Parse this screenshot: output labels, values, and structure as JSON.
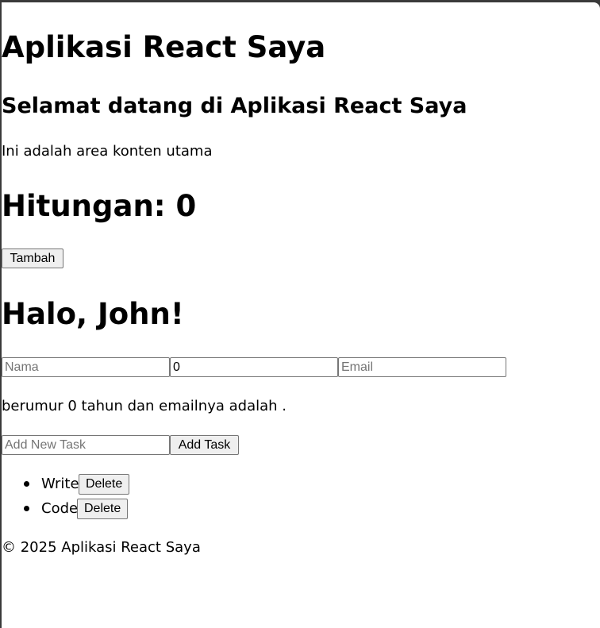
{
  "header": {
    "title": "Aplikasi React Saya"
  },
  "main": {
    "welcome_title": "Selamat datang di Aplikasi React Saya",
    "description": "Ini adalah area konten utama"
  },
  "counter": {
    "label": "Hitungan: 0",
    "add_button_label": "Tambah"
  },
  "user": {
    "greeting": "Halo, John!",
    "name_field": {
      "value": "",
      "placeholder": "Nama"
    },
    "age_field": {
      "value": "0",
      "placeholder": ""
    },
    "email_field": {
      "value": "",
      "placeholder": "Email"
    },
    "summary": "berumur 0 tahun dan emailnya adalah ."
  },
  "tasks": {
    "new_task_placeholder": "Add New Task",
    "add_task_button_label": "Add Task",
    "items": [
      {
        "label": "Write",
        "delete_label": "Delete"
      },
      {
        "label": "Code",
        "delete_label": "Delete"
      }
    ]
  },
  "footer": {
    "text": "© 2025 Aplikasi React Saya"
  }
}
